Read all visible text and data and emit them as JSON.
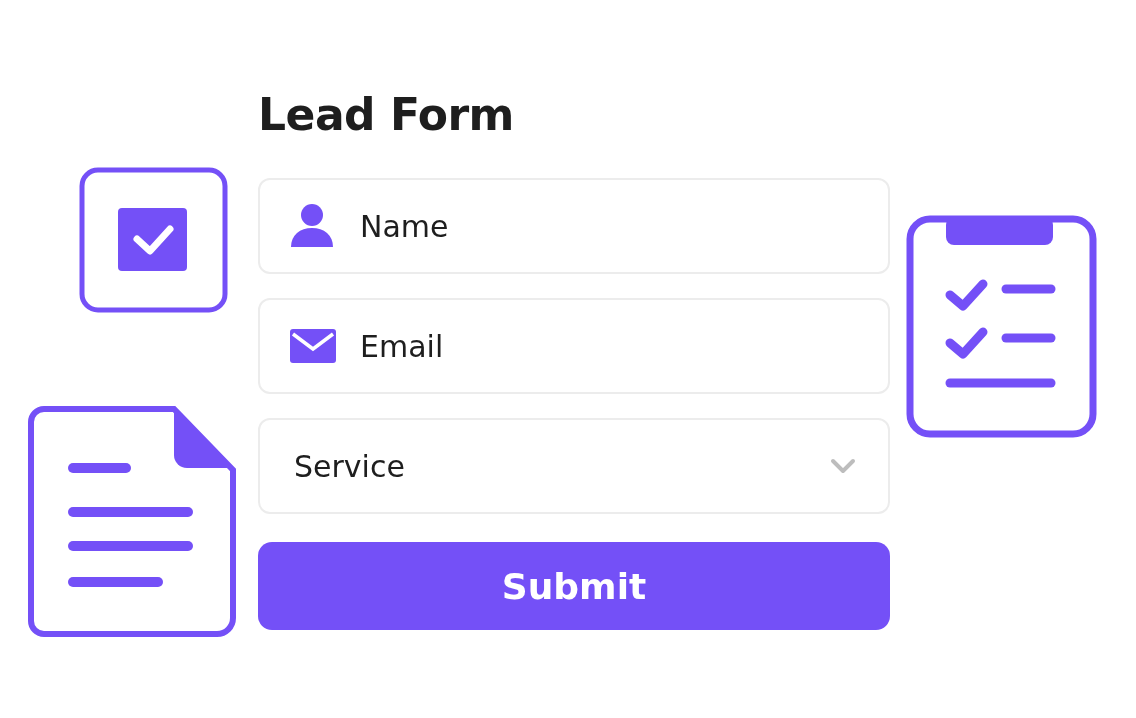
{
  "title": "Lead Form",
  "fields": [
    {
      "kind": "name",
      "placeholder": "Name"
    },
    {
      "kind": "email",
      "placeholder": "Email"
    },
    {
      "kind": "select",
      "placeholder": "Service"
    }
  ],
  "submit": {
    "label": "Submit"
  }
}
